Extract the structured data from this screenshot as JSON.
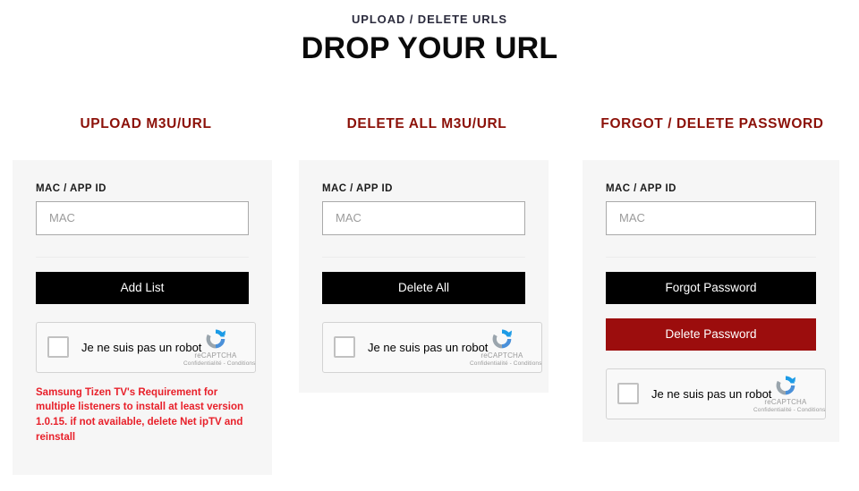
{
  "header": {
    "eyebrow": "UPLOAD / DELETE URLS",
    "title": "DROP YOUR URL"
  },
  "colors": {
    "column_title": "#8c1109",
    "button_dark": "#000000",
    "button_danger": "#9c0d0d",
    "warning_text": "#e8202a",
    "card_background": "#f6f6f6"
  },
  "recaptcha": {
    "label": "Je ne suis pas un robot",
    "brand": "reCAPTCHA",
    "terms": "Confidentialité - Conditions",
    "logo_icon": "recaptcha-logo-icon"
  },
  "columns": [
    {
      "id": "upload",
      "title": "UPLOAD M3U/URL",
      "field_label": "MAC / APP ID",
      "input_placeholder": "MAC",
      "input_value": "",
      "buttons": [
        {
          "label": "Add List",
          "style": "dark",
          "name": "add-list-button"
        }
      ],
      "warning": "Samsung Tizen TV's Requirement for multiple listeners to install at least version 1.0.15. if not available, delete Net ipTV and reinstall"
    },
    {
      "id": "delete-all",
      "title": "DELETE ALL M3U/URL",
      "field_label": "MAC / APP ID",
      "input_placeholder": "MAC",
      "input_value": "",
      "buttons": [
        {
          "label": "Delete All",
          "style": "dark",
          "name": "delete-all-button"
        }
      ],
      "warning": ""
    },
    {
      "id": "password",
      "title": "FORGOT / DELETE PASSWORD",
      "field_label": "MAC / APP ID",
      "input_placeholder": "MAC",
      "input_value": "",
      "buttons": [
        {
          "label": "Forgot Password",
          "style": "dark",
          "name": "forgot-password-button"
        },
        {
          "label": "Delete Password",
          "style": "danger",
          "name": "delete-password-button"
        }
      ],
      "warning": ""
    }
  ]
}
